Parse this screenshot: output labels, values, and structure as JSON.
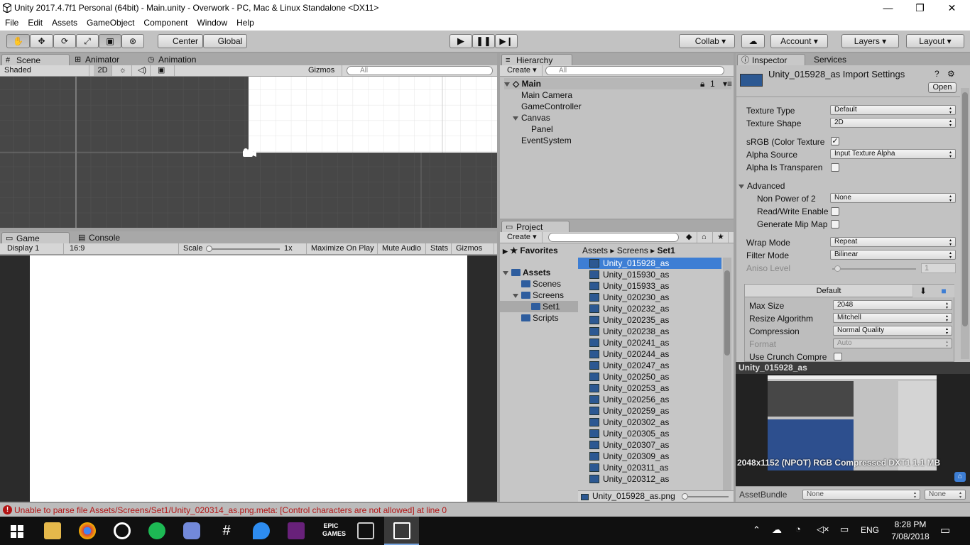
{
  "window": {
    "title": "Unity 2017.4.7f1 Personal (64bit) - Main.unity - Overwork - PC, Mac & Linux Standalone <DX11>",
    "minimize": "—",
    "maximize": "❐",
    "close": "✕"
  },
  "menu": [
    "File",
    "Edit",
    "Assets",
    "GameObject",
    "Component",
    "Window",
    "Help"
  ],
  "toolbar": {
    "center": "Center",
    "global": "Global",
    "collab": "Collab",
    "account": "Account",
    "layers": "Layers",
    "layout": "Layout"
  },
  "scene": {
    "tabs": [
      "Scene",
      "Animator",
      "Animation"
    ],
    "shading": "Shaded",
    "mode2d": "2D",
    "gizmos": "Gizmos",
    "search": "All"
  },
  "game": {
    "tabs": [
      "Game",
      "Console"
    ],
    "display": "Display 1",
    "aspect": "16:9",
    "scale_label": "Scale",
    "scale_value": "1x",
    "maximize": "Maximize On Play",
    "mute": "Mute Audio",
    "stats": "Stats",
    "gizmos": "Gizmos"
  },
  "hierarchy": {
    "tab": "Hierarchy",
    "create": "Create",
    "search": "All",
    "scene_name": "Main",
    "scene_count": "1",
    "items": [
      "Main Camera",
      "GameController",
      "Canvas",
      "Panel",
      "EventSystem"
    ]
  },
  "project": {
    "tab": "Project",
    "create": "Create",
    "favorites": "Favorites",
    "assets": "Assets",
    "tree": [
      "Scenes",
      "Screens",
      "Set1",
      "Scripts"
    ],
    "breadcrumb": [
      "Assets",
      "Screens",
      "Set1"
    ],
    "files": [
      "Unity_015928_as",
      "Unity_015930_as",
      "Unity_015933_as",
      "Unity_020230_as",
      "Unity_020232_as",
      "Unity_020235_as",
      "Unity_020238_as",
      "Unity_020241_as",
      "Unity_020244_as",
      "Unity_020247_as",
      "Unity_020250_as",
      "Unity_020253_as",
      "Unity_020256_as",
      "Unity_020259_as",
      "Unity_020302_as",
      "Unity_020305_as",
      "Unity_020307_as",
      "Unity_020309_as",
      "Unity_020311_as",
      "Unity_020312_as"
    ],
    "footer_file": "Unity_015928_as.png"
  },
  "inspector": {
    "tabs": [
      "Inspector",
      "Services"
    ],
    "title": "Unity_015928_as Import Settings",
    "open": "Open",
    "texture_type_label": "Texture Type",
    "texture_type": "Default",
    "texture_shape_label": "Texture Shape",
    "texture_shape": "2D",
    "srgb_label": "sRGB (Color Texture",
    "alpha_source_label": "Alpha Source",
    "alpha_source": "Input Texture Alpha",
    "alpha_transparency_label": "Alpha Is Transparen",
    "advanced": "Advanced",
    "npot_label": "Non Power of 2",
    "npot": "None",
    "readwrite_label": "Read/Write Enable",
    "mipmap_label": "Generate Mip Map",
    "wrap_label": "Wrap Mode",
    "wrap": "Repeat",
    "filter_label": "Filter Mode",
    "filter": "Bilinear",
    "aniso_label": "Aniso Level",
    "aniso": "1",
    "platform": "Default",
    "maxsize_label": "Max Size",
    "maxsize": "2048",
    "resize_label": "Resize Algorithm",
    "resize": "Mitchell",
    "compression_label": "Compression",
    "compression": "Normal Quality",
    "format_label": "Format",
    "format": "Auto",
    "crunch_label": "Use Crunch Compre",
    "preview_title": "Unity_015928_as",
    "preview_info": "2048x1152 (NPOT)  RGB Compressed DXT1   1.1 MB",
    "assetbundle_label": "AssetBundle",
    "assetbundle": "None",
    "variant": "None"
  },
  "status": {
    "error": "Unable to parse file Assets/Screens/Set1/Unity_020314_as.png.meta: [Control characters are not allowed] at line 0"
  },
  "taskbar": {
    "lang": "ENG",
    "time": "8:28 PM",
    "date": "7/08/2018"
  },
  "colors": {
    "selection": "#3d7ed4",
    "panel": "#c2c2c2",
    "scene_bg": "#474747",
    "error": "#b31515"
  }
}
